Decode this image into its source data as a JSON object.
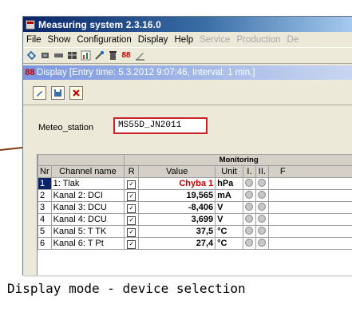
{
  "window": {
    "title": "Measuring system   2.3.16.0"
  },
  "menu": [
    {
      "label": "File",
      "enabled": true
    },
    {
      "label": "Show",
      "enabled": true
    },
    {
      "label": "Configuration",
      "enabled": true
    },
    {
      "label": "Display",
      "enabled": true
    },
    {
      "label": "Help",
      "enabled": true
    },
    {
      "label": "Service",
      "enabled": false
    },
    {
      "label": "Production",
      "enabled": false
    },
    {
      "label": "De",
      "enabled": false
    }
  ],
  "toolbar_icons": [
    "link-icon",
    "chip-icon",
    "module-icon",
    "grid-icon",
    "chart-icon",
    "tools-icon",
    "trash-icon",
    "number-88-icon",
    "pen-icon"
  ],
  "display": {
    "title": "Display [Entry time: 5.3.2012  9:07:46, Interval: 1 min.]",
    "icon_text": "88"
  },
  "display_toolbar_icons": [
    "edit-icon",
    "save-icon",
    "close-chart-icon"
  ],
  "tabs": {
    "first": "Meteo_station",
    "selected_device": "MS55D_JN2011"
  },
  "table": {
    "group_header": "Monitoring",
    "columns": {
      "nr": "Nr",
      "name": "Channel name",
      "r": "R",
      "value": "Value",
      "unit": "Unit",
      "i": "I.",
      "ii": "II.",
      "extra": "F"
    },
    "rows": [
      {
        "nr": "1",
        "name": "1: Tlak",
        "value": "Chyba 1",
        "unit": "hPa",
        "error": true
      },
      {
        "nr": "2",
        "name": "Kanal 2: DCI",
        "value": "19,565",
        "unit": "mA",
        "error": false
      },
      {
        "nr": "3",
        "name": "Kanal 3: DCU",
        "value": "-8,406",
        "unit": "V",
        "error": false
      },
      {
        "nr": "4",
        "name": "Kanal 4: DCU",
        "value": "3,699",
        "unit": "V",
        "error": false
      },
      {
        "nr": "5",
        "name": "Kanal 5: T TK",
        "value": "37,5",
        "unit": "°C",
        "error": false
      },
      {
        "nr": "6",
        "name": "Kanal 6: T Pt",
        "value": "27,4",
        "unit": "°C",
        "error": false
      }
    ]
  },
  "caption": "Display mode - device selection",
  "colors": {
    "highlight_border": "#cc2222",
    "arrow": "#7a3d10",
    "error_value": "#d40000"
  }
}
